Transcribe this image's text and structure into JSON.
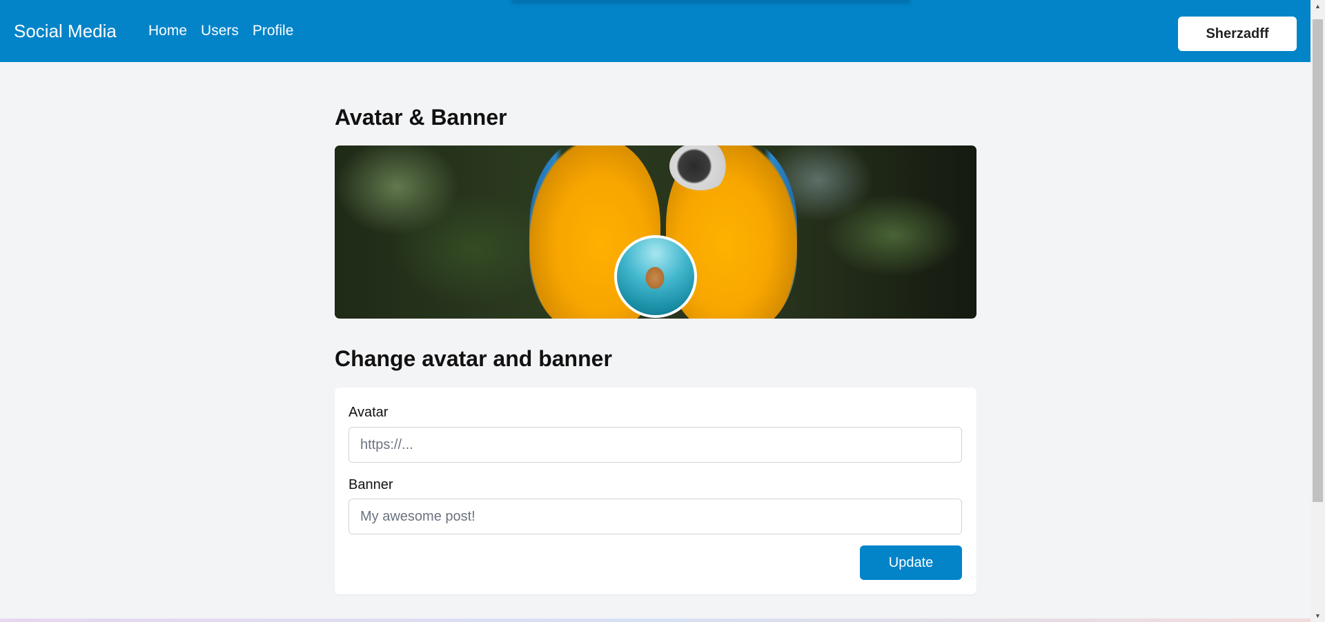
{
  "navbar": {
    "brand": "Social Media",
    "links": [
      "Home",
      "Users",
      "Profile"
    ],
    "user_button": "Sherzadff"
  },
  "colors": {
    "primary": "#0384c9",
    "page_background": "#f3f4f6",
    "card_background": "#ffffff"
  },
  "media_section": {
    "title": "Avatar & Banner",
    "banner_image": "parrots-banner",
    "avatar_image": "dog-swimming-avatar"
  },
  "form_section": {
    "title": "Change avatar and banner",
    "avatar_label": "Avatar",
    "avatar_placeholder": "https://...",
    "banner_label": "Banner",
    "banner_placeholder": "My awesome post!",
    "submit_label": "Update"
  }
}
